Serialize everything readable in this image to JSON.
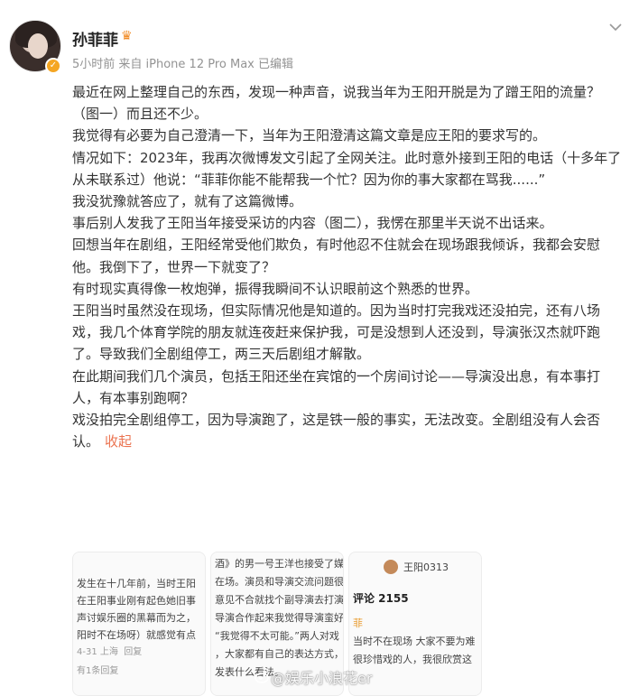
{
  "post": {
    "author": "孙菲菲",
    "badge_icon": "crown-icon",
    "verified_icon": "verified-badge-icon",
    "meta": "5小时前  来自 iPhone 12 Pro Max 已编辑",
    "menu_icon": "chevron-down-icon",
    "paragraphs": [
      "最近在网上整理自己的东西，发现一种声音，说我当年为王阳开脱是为了蹭王阳的流量？（图一）而且还不少。",
      "我觉得有必要为自己澄清一下，当年为王阳澄清这篇文章是应王阳的要求写的。",
      "情况如下：2023年，我再次微博发文引起了全网关注。此时意外接到王阳的电话（十多年了从未联系过）他说：“菲菲你能不能帮我一个忙？因为你的事大家都在骂我......”",
      "我没犹豫就答应了，就有了这篇微博。",
      "事后别人发我了王阳当年接受采访的内容（图二），我愣在那里半天说不出话来。",
      "回想当年在剧组，王阳经常受他们欺负，有时他忍不住就会在现场跟我倾诉，我都会安慰他。我倒下了，世界一下就变了？",
      "有时现实真得像一枚炮弹，振得我瞬间不认识眼前这个熟悉的世界。",
      "王阳当时虽然没在现场，但实际情况他是知道的。因为当时打完我戏还没拍完，还有八场戏，我几个体育学院的朋友就连夜赶来保护我，可是没想到人还没到，导演张汉杰就吓跑了。导致我们全剧组停工，两三天后剧组才解散。",
      "在此期间我们几个演员，包括王阳还坐在宾馆的一个房间讨论——导演没出息，有本事打人，有本事别跑啊？",
      "戏没拍完全剧组停工，因为导演跑了，这是铁一般的事实，无法改变。全剧组没有人会否认。"
    ],
    "collapse_label": "收起"
  },
  "thumbnails": [
    {
      "lines": [
        "发生在十几年前，当时王阳",
        "在王阳事业刚有起色她旧事",
        "声讨娱乐圈的黑幕而为之，",
        "阳时不在场呀）就感觉有点"
      ],
      "date": "4-31 上海",
      "reply": "回复",
      "more": "有1条回复"
    },
    {
      "lines": [
        "酒》的男一号王洋也接受了媒体",
        "在场。演员和导演交流问题很",
        "意见不合就找个副导演去打演员",
        "导演合作起来我觉得导演蛮好的",
        "“我觉得不太可能。”两人对戏",
        "，大家都有自己的表达方式，",
        "发表什么看法。"
      ]
    },
    {
      "user": "王阳0313",
      "comments": "评论 2155",
      "lines": [
        "菲",
        "当时不在现场 大家不要为难",
        "很珍惜戏的人，我很欣赏这"
      ]
    }
  ],
  "watermark": "@娱乐小浪花er"
}
